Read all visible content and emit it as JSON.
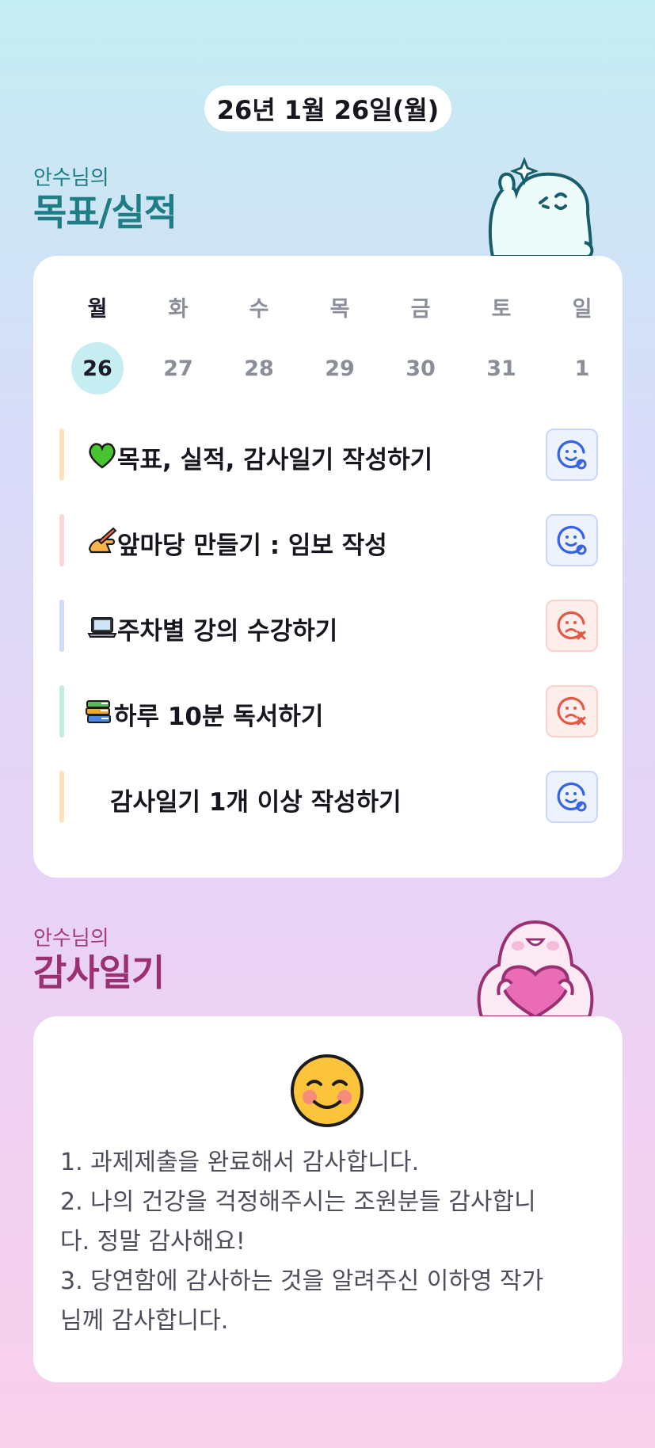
{
  "header": {
    "date": "26년 1월 26일(월)"
  },
  "goals_section": {
    "subtitle": "안수님의",
    "title": "목표/실적"
  },
  "calendar": {
    "days": [
      "월",
      "화",
      "수",
      "목",
      "금",
      "토",
      "일"
    ],
    "dates": [
      "26",
      "27",
      "28",
      "29",
      "30",
      "31",
      "1"
    ],
    "selected_date": "26"
  },
  "tasks": [
    {
      "icon": "green-heart-icon",
      "label": "목표, 실적, 감사일기 작성하기",
      "status": "achieved",
      "bar_color": "#fbe2bd"
    },
    {
      "icon": "writing-hand-icon",
      "label": "앞마당 만들기 : 임보 작성",
      "status": "achieved",
      "bar_color": "#fbd6d6"
    },
    {
      "icon": "laptop-icon",
      "label": "주차별 강의 수강하기",
      "status": "missed",
      "bar_color": "#cfdcf8"
    },
    {
      "icon": "books-icon",
      "label": "하루 10분 독서하기",
      "status": "missed",
      "bar_color": "#bfeedb"
    },
    {
      "icon": "",
      "label": "감사일기 1개 이상 작성하기",
      "status": "achieved",
      "bar_color": "#fbe2bd"
    }
  ],
  "diary_section": {
    "subtitle": "안수님의",
    "title": "감사일기"
  },
  "diary": {
    "mood_icon": "smiling-face-icon",
    "text": "1. 과제제출을 완료해서 감사합니다.\n2. 나의 건강을 걱정해주시는 조원분들 감사합니\n다. 정말 감사해요!\n3. 당연함에 감사하는 것을 알려주신 이하영 작가\n님께 감사합니다."
  },
  "colors": {
    "goal_title": "#1f7d85",
    "diary_title": "#9b2f74",
    "selected_date_bg": "#c5edf2",
    "ok_icon": "#3563e9",
    "bad_icon": "#e25a47"
  }
}
